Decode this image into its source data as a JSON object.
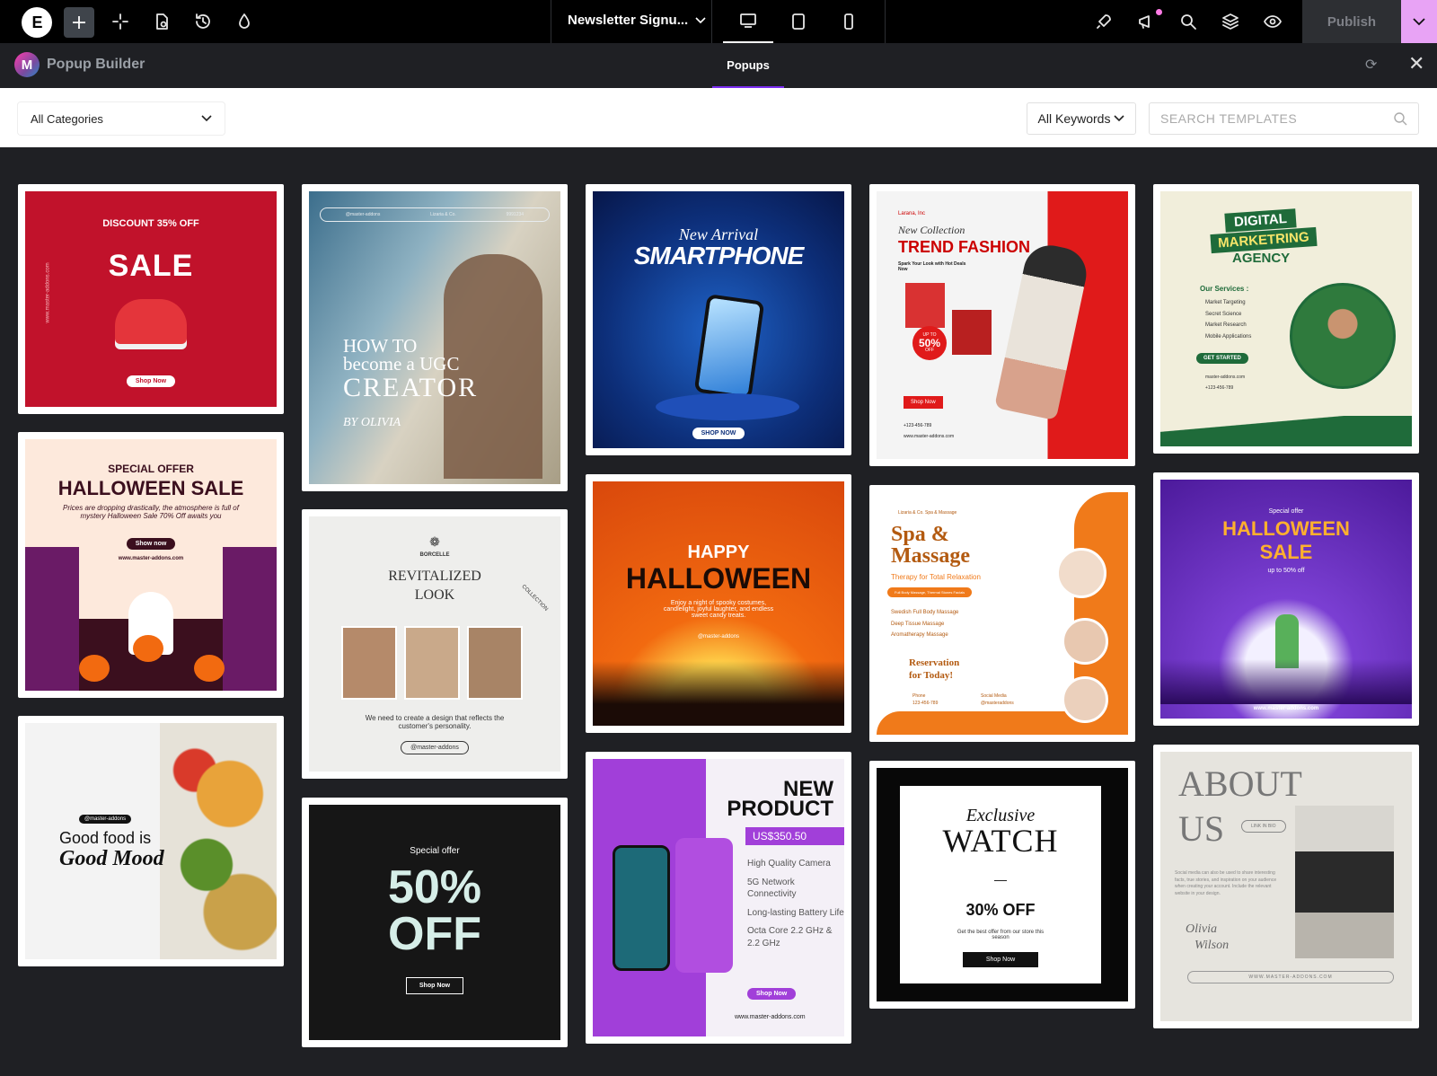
{
  "topbar": {
    "document_name": "Newsletter Signu...",
    "publish_label": "Publish"
  },
  "subbar": {
    "app_title": "Popup Builder",
    "app_logo_letter": "M",
    "tab_label": "Popups"
  },
  "filters": {
    "category": "All Categories",
    "keywords": "All Keywords",
    "search_placeholder": "SEARCH TEMPLATES"
  },
  "templates": {
    "sale": {
      "heading": "DISCOUNT 35% OFF",
      "title": "SALE",
      "button": "Shop Now",
      "side_text": "www.master-addons.com"
    },
    "halloween_offer": {
      "kicker": "SPECIAL OFFER",
      "title": "HALLOWEEN SALE",
      "body": "Prices are dropping drastically, the atmosphere is full of mystery Halloween Sale 70% Off awaits you",
      "button": "Show now",
      "url": "www.master-addons.com"
    },
    "food": {
      "tag": "@master-addons",
      "line1": "Good food is",
      "line2": "Good Mood"
    },
    "ugc": {
      "bar_left": "@master-addons",
      "bar_mid": "Lizaria & Co.",
      "bar_right": "9991234",
      "line1": "HOW TO",
      "line2": "become a UGC",
      "line3": "CREATOR",
      "by": "BY   OLIVIA"
    },
    "revitalized": {
      "brand": "BORCELLE",
      "title1": "REVITALIZED",
      "title2": "LOOK",
      "ring": "COLLECTION",
      "body": "We need to create a design that reflects the customer's personality.",
      "button": "@master-addons"
    },
    "offer50": {
      "kicker": "Special offer",
      "big1": "50%",
      "big2": "OFF",
      "button": "Shop Now"
    },
    "smartphone": {
      "script": "New Arrival",
      "title": "SMARTPHONE",
      "button": "SHOP NOW"
    },
    "happy_halloween": {
      "line1": "HAPPY",
      "line2": "HALLOWEEN",
      "body": "Enjoy a night of spooky costumes, candlelight, joyful laughter, and endless sweet candy treats.",
      "url": "@master-addons"
    },
    "new_product": {
      "line1": "NEW",
      "line2": "PRODUCT",
      "price": "US$350.50",
      "features": [
        "High Quality Camera",
        "5G Network Connectivity",
        "Long-lasting Battery Life",
        "Octa Core 2.2 GHz & 2.2 GHz"
      ],
      "button": "Shop Now",
      "url": "www.master-addons.com"
    },
    "trend": {
      "brand": "Larana, Inc",
      "script": "New Collection",
      "title": "TREND FASHION",
      "sub": "Spark Your Look with Hot Deals Now",
      "badge1": "UP TO",
      "badge2": "50%",
      "badge3": "OFF",
      "button": "Shop Now",
      "phone": "+123-456-789",
      "url": "www.master-addons.com"
    },
    "spa": {
      "brand": "Lizaria & Co. Spa & Massage",
      "title1": "Spa &",
      "title2": "Massage",
      "sub": "Therapy for Total Relaxation",
      "pill": "Full Body Massage, Thermal Stones Facials",
      "items": [
        "Swedish Full Body Massage",
        "Deep Tissue Massage",
        "Aromatherapy Massage"
      ],
      "res1": "Reservation",
      "res2": "for Today!",
      "phone_label": "Phone",
      "phone": "123-456-789",
      "social_label": "Social Media",
      "social": "@masteraddons"
    },
    "watch": {
      "script": "Exclusive",
      "title": "WATCH",
      "dash": "—",
      "discount": "30% OFF",
      "body": "Get the best offer from our store this season",
      "button": "Shop Now"
    },
    "digital": {
      "line1": "DIGITAL",
      "line2": "MARKETRING",
      "line3": "AGENCY",
      "services_title": "Our Services :",
      "services": [
        "Market Targeting",
        "Secret Science",
        "Market Research",
        "Mobile Applications"
      ],
      "button": "GET STARTED",
      "web": "master-addons.com",
      "phone": "+123-456-789"
    },
    "halloween_purple": {
      "kicker": "Special offer",
      "line1": "HALLOWEEN",
      "line2": "SALE",
      "sub": "up to 50% off",
      "url": "www.master-addons.com"
    },
    "about": {
      "line1": "ABOUT",
      "line2": "US",
      "pill": "LINK IN BIO",
      "body": "Social media can also be used to share interesting facts, true stories, and inspiration on your audience when creating your account. Include the relevant website in your design.",
      "sig1": "Olivia",
      "sig2": "Wilson",
      "url": "WWW.MASTER-ADDONS.COM"
    }
  },
  "colors": {
    "accent_purple": "#7b2cf0",
    "publish_arrow": "#e8a3f5",
    "sale_red": "#c1122b",
    "halloween_orange": "#f26a10",
    "spa_orange": "#f07a1a",
    "digital_green": "#1f6b3a"
  }
}
